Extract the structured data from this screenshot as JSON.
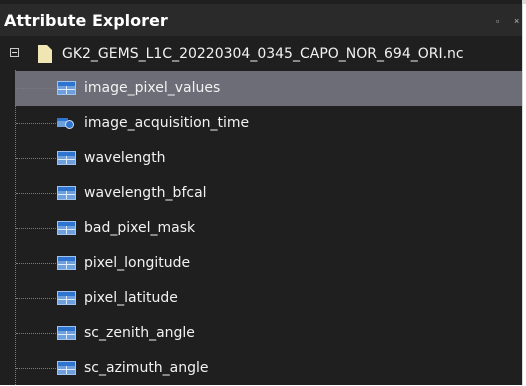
{
  "panel": {
    "title": "Attribute Explorer",
    "float_glyph": "▫",
    "close_glyph": "×"
  },
  "tree": {
    "root_label": "GK2_GEMS_L1C_20220304_0345_CAPO_NOR_694_ORI.nc",
    "items": [
      {
        "label": "image_pixel_values",
        "icon": "table-icon",
        "selected": true
      },
      {
        "label": "image_acquisition_time",
        "icon": "time-attribute-icon",
        "selected": false
      },
      {
        "label": "wavelength",
        "icon": "table-icon",
        "selected": false
      },
      {
        "label": "wavelength_bfcal",
        "icon": "table-icon",
        "selected": false
      },
      {
        "label": "bad_pixel_mask",
        "icon": "table-icon",
        "selected": false
      },
      {
        "label": "pixel_longitude",
        "icon": "table-icon",
        "selected": false
      },
      {
        "label": "pixel_latitude",
        "icon": "table-icon",
        "selected": false
      },
      {
        "label": "sc_zenith_angle",
        "icon": "table-icon",
        "selected": false
      },
      {
        "label": "sc_azimuth_angle",
        "icon": "table-icon",
        "selected": false
      }
    ]
  },
  "colors": {
    "background": "#1f1f1f",
    "selection": "#6d6d78",
    "icon_blue": "#2f74cf"
  }
}
